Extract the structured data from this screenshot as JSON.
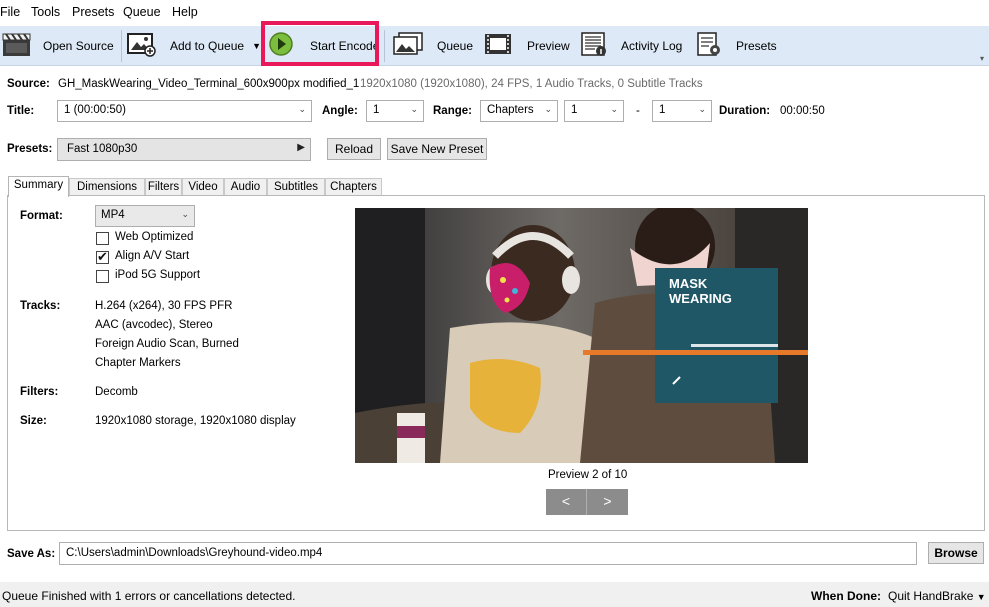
{
  "menu": [
    "File",
    "Tools",
    "Presets",
    "Queue",
    "Help"
  ],
  "toolbar": {
    "open_source": "Open Source",
    "add_to_queue": "Add to Queue",
    "start_encode": "Start Encode",
    "queue": "Queue",
    "preview": "Preview",
    "activity_log": "Activity Log",
    "presets": "Presets",
    "highlight_color": "#e8185a"
  },
  "source": {
    "label": "Source:",
    "name": "GH_MaskWearing_Video_Terminal_600x900px modified_1",
    "info": "1920x1080 (1920x1080), 24 FPS, 1 Audio Tracks, 0 Subtitle Tracks"
  },
  "title_row": {
    "title_label": "Title:",
    "title_value": "1 (00:00:50)",
    "angle_label": "Angle:",
    "angle_value": "1",
    "range_label": "Range:",
    "range_type": "Chapters",
    "range_start": "1",
    "range_dash": "-",
    "range_end": "1",
    "duration_label": "Duration:",
    "duration_value": "00:00:50"
  },
  "presets_row": {
    "label": "Presets:",
    "selected": "Fast 1080p30",
    "reload": "Reload",
    "save_new": "Save New Preset"
  },
  "tabs": [
    "Summary",
    "Dimensions",
    "Filters",
    "Video",
    "Audio",
    "Subtitles",
    "Chapters"
  ],
  "summary": {
    "format_label": "Format:",
    "format_value": "MP4",
    "web_optimized": "Web Optimized",
    "align_av": "Align A/V Start",
    "ipod": "iPod 5G Support",
    "checks": {
      "web_optimized": false,
      "align_av": true,
      "ipod": false
    },
    "tracks_label": "Tracks:",
    "tracks": [
      "H.264 (x264), 30 FPS PFR",
      "AAC (avcodec), Stereo",
      "Foreign Audio Scan, Burned",
      "Chapter Markers"
    ],
    "filters_label": "Filters:",
    "filters_value": "Decomb",
    "size_label": "Size:",
    "size_value": "1920x1080 storage, 1920x1080 display"
  },
  "preview": {
    "overlay_line1": "MASK",
    "overlay_line2": "WEARING",
    "caption": "Preview 2 of 10",
    "prev": "<",
    "next": ">"
  },
  "save_as": {
    "label": "Save As:",
    "path": "C:\\Users\\admin\\Downloads\\Greyhound-video.mp4",
    "browse": "Browse"
  },
  "status": {
    "message": "Queue Finished with 1 errors or cancellations detected.",
    "when_done_label": "When Done:",
    "when_done_value": "Quit HandBrake"
  }
}
